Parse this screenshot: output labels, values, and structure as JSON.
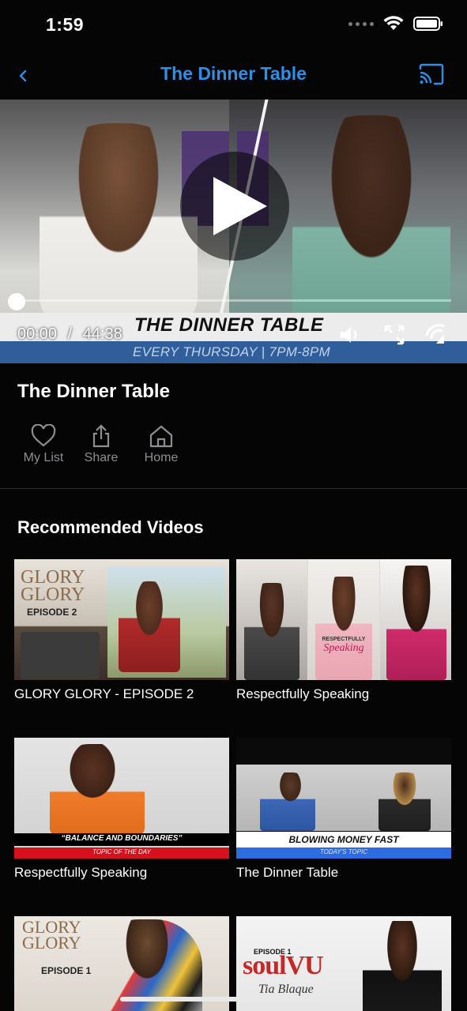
{
  "status_bar": {
    "time": "1:59"
  },
  "nav": {
    "title": "The Dinner Table"
  },
  "player": {
    "current_time": "00:00",
    "separator": "/",
    "duration": "44:38",
    "progress_fraction": 0,
    "banner_title": "THE DINNER TABLE",
    "banner_subtitle": "EVERY THURSDAY | 7PM-8PM"
  },
  "show": {
    "title": "The Dinner Table"
  },
  "actions": [
    {
      "label": "My List",
      "icon": "heart-icon"
    },
    {
      "label": "Share",
      "icon": "share-icon"
    },
    {
      "label": "Home",
      "icon": "home-icon"
    }
  ],
  "recommended": {
    "section_title": "Recommended Videos",
    "items": [
      {
        "label": "GLORY GLORY - EPISODE 2",
        "thumb_text": [
          "GLORY",
          "GLORY",
          "EPISODE 2"
        ]
      },
      {
        "label": "Respectfully Speaking",
        "thumb_text": [
          "RESPECTFULLY",
          "Speaking"
        ]
      },
      {
        "label": "Respectfully Speaking",
        "thumb_text": [
          "“BALANCE AND BOUNDARIES”",
          "TOPIC OF THE DAY"
        ]
      },
      {
        "label": "The Dinner Table",
        "thumb_text": [
          "BLOWING MONEY FAST",
          "TODAY'S TOPIC"
        ]
      },
      {
        "label": "",
        "thumb_text": [
          "GLORY",
          "GLORY",
          "EPISODE 1"
        ]
      },
      {
        "label": "",
        "thumb_text": [
          "EPISODE 1",
          "soulVU",
          "Tia Blaque"
        ]
      }
    ]
  },
  "colors": {
    "accent": "#2f8fe6",
    "muted": "#8e8e93",
    "background": "#050505"
  }
}
